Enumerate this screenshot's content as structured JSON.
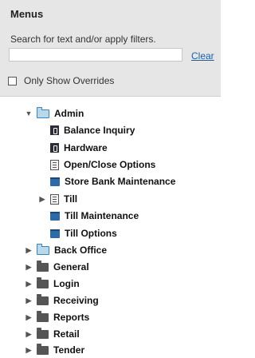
{
  "panel": {
    "title": "Menus",
    "search_hint": "Search for text and/or apply filters.",
    "search_value": "",
    "clear_label": "Clear",
    "override_label": "Only Show Overrides",
    "override_checked": false
  },
  "tree": {
    "admin": {
      "label": "Admin",
      "expanded": true,
      "icon": "folder-open-icon"
    },
    "admin_children": [
      {
        "label": "Balance Inquiry",
        "icon": "document-dark-icon"
      },
      {
        "label": "Hardware",
        "icon": "document-dark-icon"
      },
      {
        "label": "Open/Close Options",
        "icon": "document-list-icon"
      },
      {
        "label": "Store Bank Maintenance",
        "icon": "screen-icon"
      },
      {
        "label": "Till",
        "icon": "document-list-icon",
        "expandable": true
      },
      {
        "label": "Till Maintenance",
        "icon": "screen-icon"
      },
      {
        "label": "Till Options",
        "icon": "screen-icon"
      }
    ],
    "back_office": {
      "label": "Back Office",
      "icon": "folder-icon"
    },
    "folders": [
      {
        "label": "General",
        "icon": "folder-closed-icon"
      },
      {
        "label": "Login",
        "icon": "folder-closed-icon"
      },
      {
        "label": "Receiving",
        "icon": "folder-closed-icon"
      },
      {
        "label": "Reports",
        "icon": "folder-closed-icon"
      },
      {
        "label": "Retail",
        "icon": "folder-closed-icon"
      },
      {
        "label": "Tender",
        "icon": "folder-closed-icon"
      }
    ]
  }
}
